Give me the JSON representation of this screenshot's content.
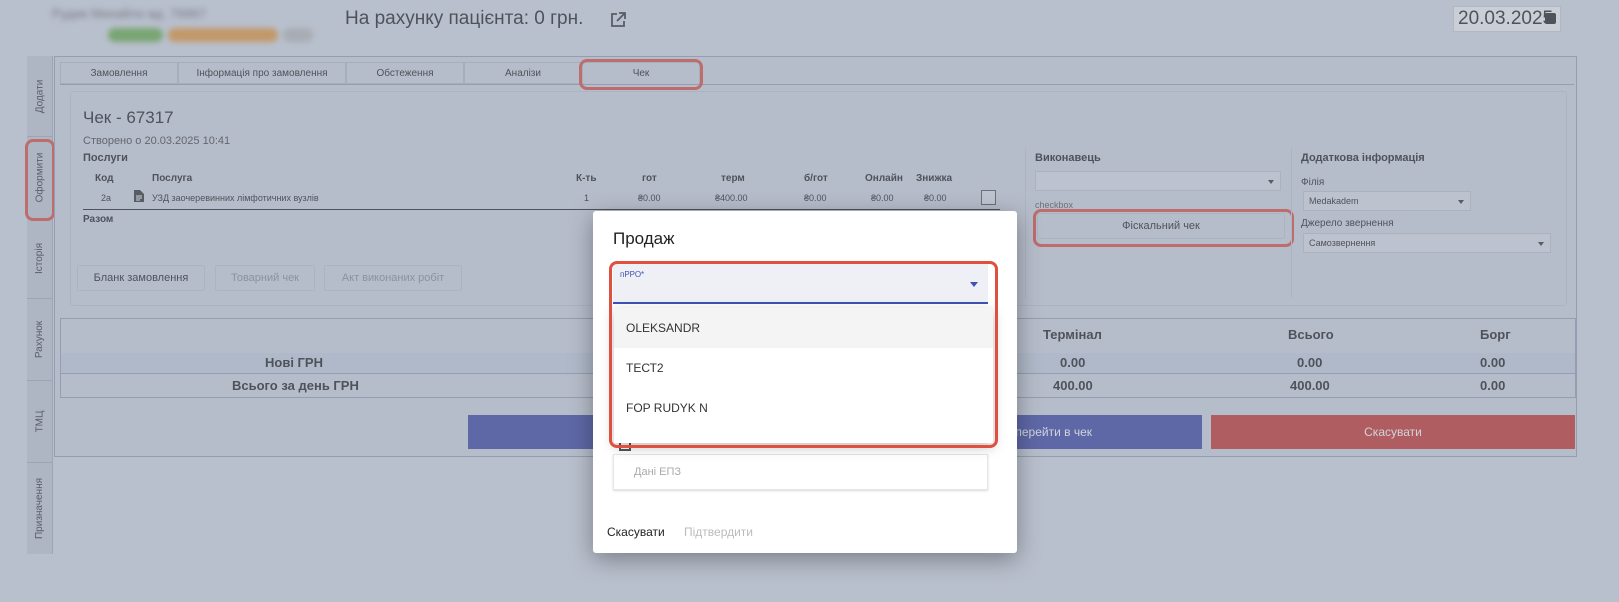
{
  "header": {
    "patient_name": "Рудик Михайло вд. 76967",
    "balance_text": "На рахунку пацієнта: 0 грн.",
    "date": "20.03.2025"
  },
  "rail": [
    "Додати",
    "Оформити",
    "Історія",
    "Рахунок",
    "ТМЦ",
    "Призначення"
  ],
  "tabs": [
    "Замовлення",
    "Інформація про замовлення",
    "Обстеження",
    "Аналізи",
    "Чек"
  ],
  "receipt": {
    "title": "Чек - 67317",
    "created": "Створено о 20.03.2025 10:41",
    "services_label": "Послуги",
    "columns": [
      "Код",
      "Послуга",
      "К-ть",
      "гот",
      "терм",
      "б/гот",
      "Онлайн",
      "Знижка"
    ],
    "row": {
      "code": "2a",
      "service": "УЗД заочеревинних лімфотичних вузлів",
      "qty": "1",
      "cash": "₴0.00",
      "term": "₴400.00",
      "noncash": "₴0.00",
      "online": "₴0.00",
      "discount": "₴0.00"
    },
    "total_label": "Разом",
    "buttons": [
      "Бланк замовлення",
      "Товарний чек",
      "Акт виконаних робіт"
    ]
  },
  "executor": {
    "label": "Виконавець",
    "select_value": "",
    "checkbox_label": "checkbox",
    "fiscal_button": "Фіскальний чек"
  },
  "extra": {
    "label": "Додаткова інформація",
    "branch_label": "Філія",
    "branch_value": "Medakadem",
    "source_label": "Джерело звернення",
    "source_value": "Самозвернення"
  },
  "summary": {
    "headers": [
      "Термінал",
      "Всього",
      "Борг"
    ],
    "rows": [
      {
        "label": "Нові ГРН",
        "terminal": "0.00",
        "total": "0.00",
        "debt": "0.00"
      },
      {
        "label": "Всього за день ГРН",
        "terminal": "400.00",
        "total": "400.00",
        "debt": "0.00"
      }
    ],
    "go_to_check": "перейти в чек",
    "cancel": "Скасувати"
  },
  "modal": {
    "title": "Продаж",
    "select_label": "пРРО*",
    "options": [
      "OLEKSANDR",
      "ТЕСТ2",
      "FOP RUDYK N"
    ],
    "epz_placeholder": "Дані ЕПЗ",
    "cancel": "Скасувати",
    "confirm": "Підтвердити"
  },
  "colors": {
    "primary": "#3f47a6",
    "danger": "#c8342e",
    "highlight": "#e0503f",
    "accent": "#3f51b5"
  }
}
